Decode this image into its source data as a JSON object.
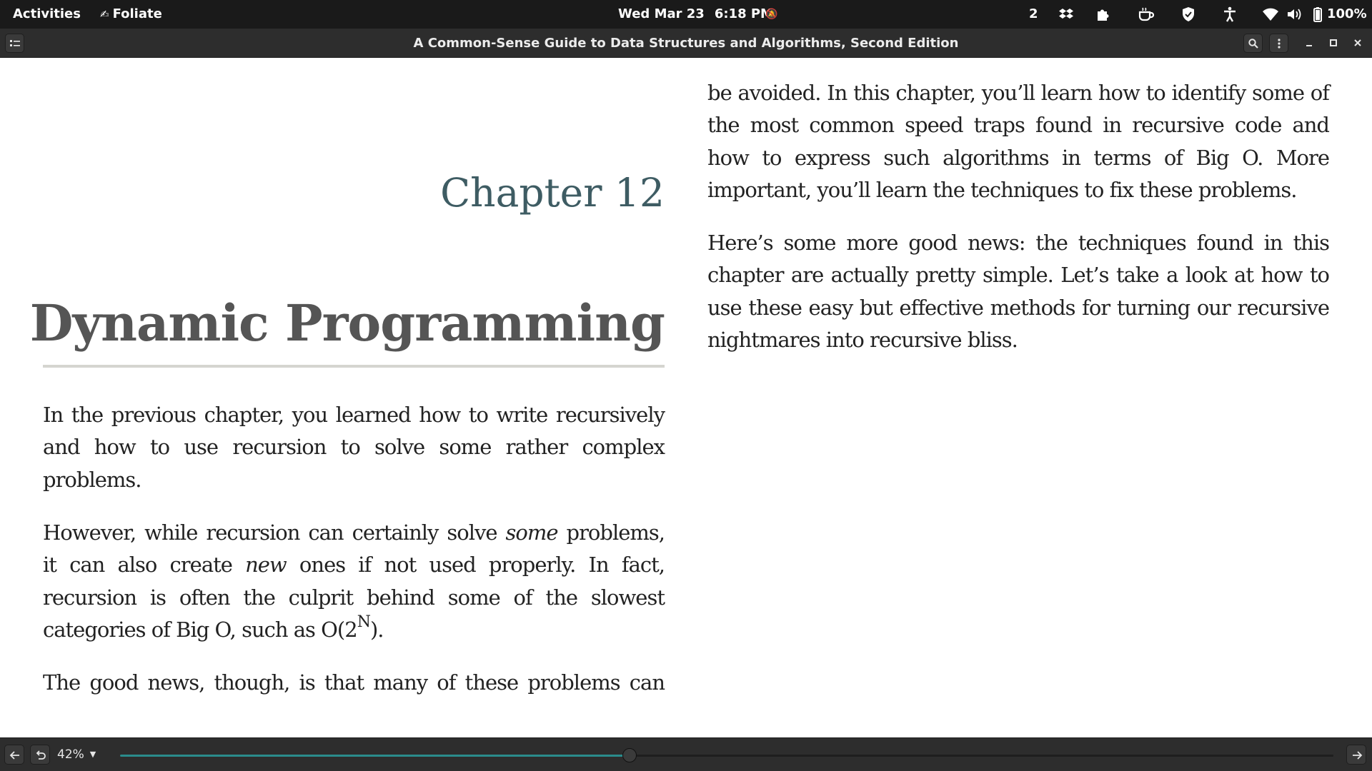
{
  "topbar": {
    "activities": "Activities",
    "app_name": "Foliate",
    "date": "Wed Mar 23",
    "time": "6:18 PM",
    "workspace": "2",
    "battery": "100%"
  },
  "header": {
    "title": "A Common-Sense Guide to Data Structures and Algorithms, Second Edition"
  },
  "book": {
    "chapter_label": "Chapter 12",
    "chapter_title": "Dynamic Programming",
    "p1": "In the previous chapter, you learned how to write recursively and how to use recursion to solve some rather complex problems.",
    "p2": {
      "a": "However, while recursion can certainly solve ",
      "some": "some",
      "b": " problems, it can also create ",
      "new": "new",
      "c": " ones if not used properly. In fact, recursion is often the culprit behind some of the slowest categories of Big O, such as O(2",
      "sup": "N",
      "d": ")."
    },
    "p3": "The good news, though, is that many of these problems can",
    "p4": "be avoided. In this chapter, you’ll learn how to identify some of the most common speed traps found in recursive code and how to express such algorithms in terms of Big O. More important, you’ll learn the techniques to fix these problems.",
    "p5": "Here’s some more good news: the techniques found in this chapter are actually pretty simple. Let’s take a look at how to use these easy but effective methods for turning our recursive nightmares into recursive bliss."
  },
  "footer": {
    "zoom": "42%",
    "progress": 0.42
  },
  "colors": {
    "accent": "#2a8c8c",
    "chapter_label": "#3e5c63",
    "chapter_title": "#555555",
    "topbar_bg": "#1a1a1a",
    "headerbar_bg": "#2d2d2d"
  },
  "icons": {
    "app_menu": "book-icon",
    "bell": "bell-off-icon",
    "tray": [
      "dropbox-icon",
      "extension-icon",
      "coffee-icon",
      "shield-icon",
      "accessibility-icon",
      "wifi-icon",
      "volume-icon",
      "battery-icon"
    ],
    "header": [
      "sidebar-toggle-icon",
      "search-icon",
      "menu-dots-icon",
      "minimize-icon",
      "maximize-icon",
      "close-icon"
    ],
    "footer": [
      "back-arrow-icon",
      "undo-icon",
      "forward-arrow-icon"
    ]
  }
}
